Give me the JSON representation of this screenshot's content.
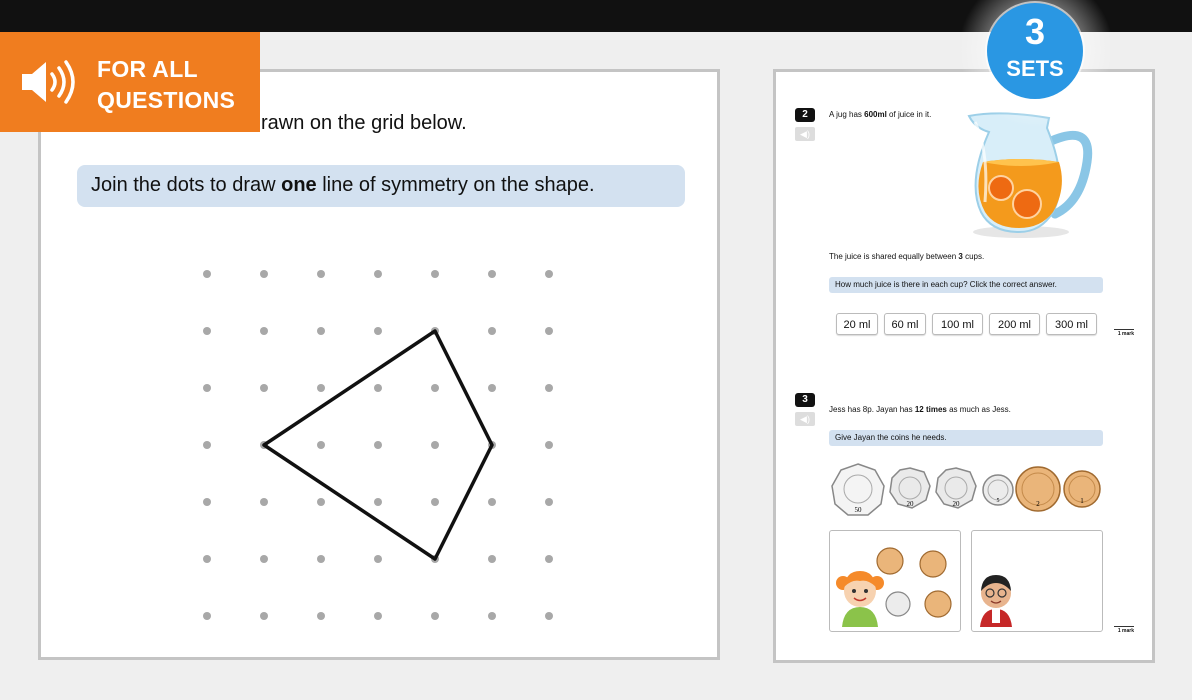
{
  "banner": {
    "line1": "FOR ALL",
    "line2": "QUESTIONS",
    "icon": "speaker-icon",
    "color": "#f07d1f"
  },
  "badge": {
    "number": "3",
    "label": "SETS",
    "color": "#2a97e3"
  },
  "left": {
    "intro": "rawn on the grid below.",
    "instruction_before": "Join the dots to draw ",
    "instruction_bold": "one",
    "instruction_after": " line of symmetry on the shape."
  },
  "right": {
    "q2": {
      "number": "2",
      "text_before": "A jug has ",
      "text_bold": "600ml",
      "text_after": " of juice in it.",
      "share_before": "The juice is shared equally between ",
      "share_bold": "3",
      "share_after": " cups.",
      "prompt": "How much juice is there in each cup? Click the correct answer.",
      "answers": [
        "20 ml",
        "60 ml",
        "100 ml",
        "200 ml",
        "300 ml"
      ],
      "mark": "1 mark"
    },
    "q3": {
      "number": "3",
      "text_before": "Jess has 8p. Jayan has ",
      "text_bold": "12 times",
      "text_after": " as much as Jess.",
      "prompt": "Give Jayan the coins he needs.",
      "coin_values": [
        "50",
        "20",
        "20",
        "5",
        "2",
        "1"
      ],
      "mark": "1 mark"
    }
  }
}
